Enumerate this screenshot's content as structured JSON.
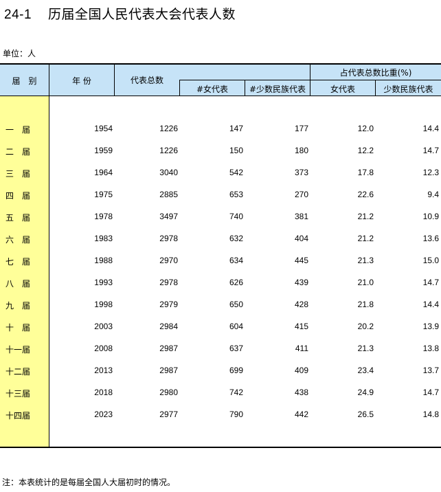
{
  "title": {
    "number": "24-1",
    "text": "历届全国人民代表大会代表人数"
  },
  "unit": "单位：人",
  "headers": {
    "session": "届　别",
    "year": "年 份",
    "total": "代表总数",
    "women": "#女代表",
    "minority": "#少数民族代表",
    "ratio_group": "占代表总数比重(%)",
    "ratio_women": "女代表",
    "ratio_minority": "少数民族代表"
  },
  "rows": [
    {
      "session": "一　届",
      "year": "1954",
      "total": "1226",
      "women": "147",
      "minority": "177",
      "pw": "12.0",
      "pm": "14.4"
    },
    {
      "session": "二　届",
      "year": "1959",
      "total": "1226",
      "women": "150",
      "minority": "180",
      "pw": "12.2",
      "pm": "14.7"
    },
    {
      "session": "三　届",
      "year": "1964",
      "total": "3040",
      "women": "542",
      "minority": "373",
      "pw": "17.8",
      "pm": "12.3"
    },
    {
      "session": "四　届",
      "year": "1975",
      "total": "2885",
      "women": "653",
      "minority": "270",
      "pw": "22.6",
      "pm": "9.4"
    },
    {
      "session": "五　届",
      "year": "1978",
      "total": "3497",
      "women": "740",
      "minority": "381",
      "pw": "21.2",
      "pm": "10.9"
    },
    {
      "session": "六　届",
      "year": "1983",
      "total": "2978",
      "women": "632",
      "minority": "404",
      "pw": "21.2",
      "pm": "13.6"
    },
    {
      "session": "七　届",
      "year": "1988",
      "total": "2970",
      "women": "634",
      "minority": "445",
      "pw": "21.3",
      "pm": "15.0"
    },
    {
      "session": "八　届",
      "year": "1993",
      "total": "2978",
      "women": "626",
      "minority": "439",
      "pw": "21.0",
      "pm": "14.7"
    },
    {
      "session": "九　届",
      "year": "1998",
      "total": "2979",
      "women": "650",
      "minority": "428",
      "pw": "21.8",
      "pm": "14.4"
    },
    {
      "session": "十　届",
      "year": "2003",
      "total": "2984",
      "women": "604",
      "minority": "415",
      "pw": "20.2",
      "pm": "13.9"
    },
    {
      "session": "十一届",
      "year": "2008",
      "total": "2987",
      "women": "637",
      "minority": "411",
      "pw": "21.3",
      "pm": "13.8"
    },
    {
      "session": "十二届",
      "year": "2013",
      "total": "2987",
      "women": "699",
      "minority": "409",
      "pw": "23.4",
      "pm": "13.7"
    },
    {
      "session": "十三届",
      "year": "2018",
      "total": "2980",
      "women": "742",
      "minority": "438",
      "pw": "24.9",
      "pm": "14.7"
    },
    {
      "session": "十四届",
      "year": "2023",
      "total": "2977",
      "women": "790",
      "minority": "442",
      "pw": "26.5",
      "pm": "14.8"
    }
  ],
  "note": "注：本表统计的是每届全国人大届初时的情况。",
  "colors": {
    "header_bg": "#c6e3f7",
    "stub_bg": "#ffff99"
  }
}
